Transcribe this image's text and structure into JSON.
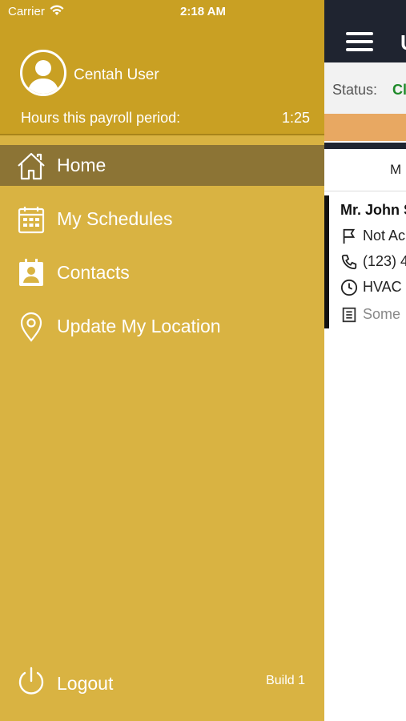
{
  "status_bar": {
    "carrier": "Carrier",
    "time": "2:18 AM"
  },
  "drawer": {
    "user_name": "Centah User",
    "hours_label": "Hours this payroll period:",
    "hours_value": "1:25",
    "menu": [
      {
        "label": "Home",
        "icon": "home-icon",
        "active": true
      },
      {
        "label": "My Schedules",
        "icon": "calendar-icon",
        "active": false
      },
      {
        "label": "Contacts",
        "icon": "contact-card-icon",
        "active": false
      },
      {
        "label": "Update My Location",
        "icon": "location-pin-icon",
        "active": false
      }
    ],
    "logout_label": "Logout",
    "build": "Build 1"
  },
  "main": {
    "title_fragment": "U",
    "status_label": "Status:",
    "status_value": "Cl",
    "tab_fragment": "M",
    "card": {
      "name": "Mr. John S",
      "flag_text": "Not Ac",
      "phone_text": "(123) 4",
      "time_text": "HVAC",
      "note_text": "Some"
    }
  },
  "colors": {
    "drawer_bg": "#d9b342",
    "drawer_header": "#c9a023",
    "active_item": "#8c7435",
    "topbar": "#1f2430",
    "status_ok": "#1f8a2a",
    "orange_banner": "#e8a862"
  }
}
